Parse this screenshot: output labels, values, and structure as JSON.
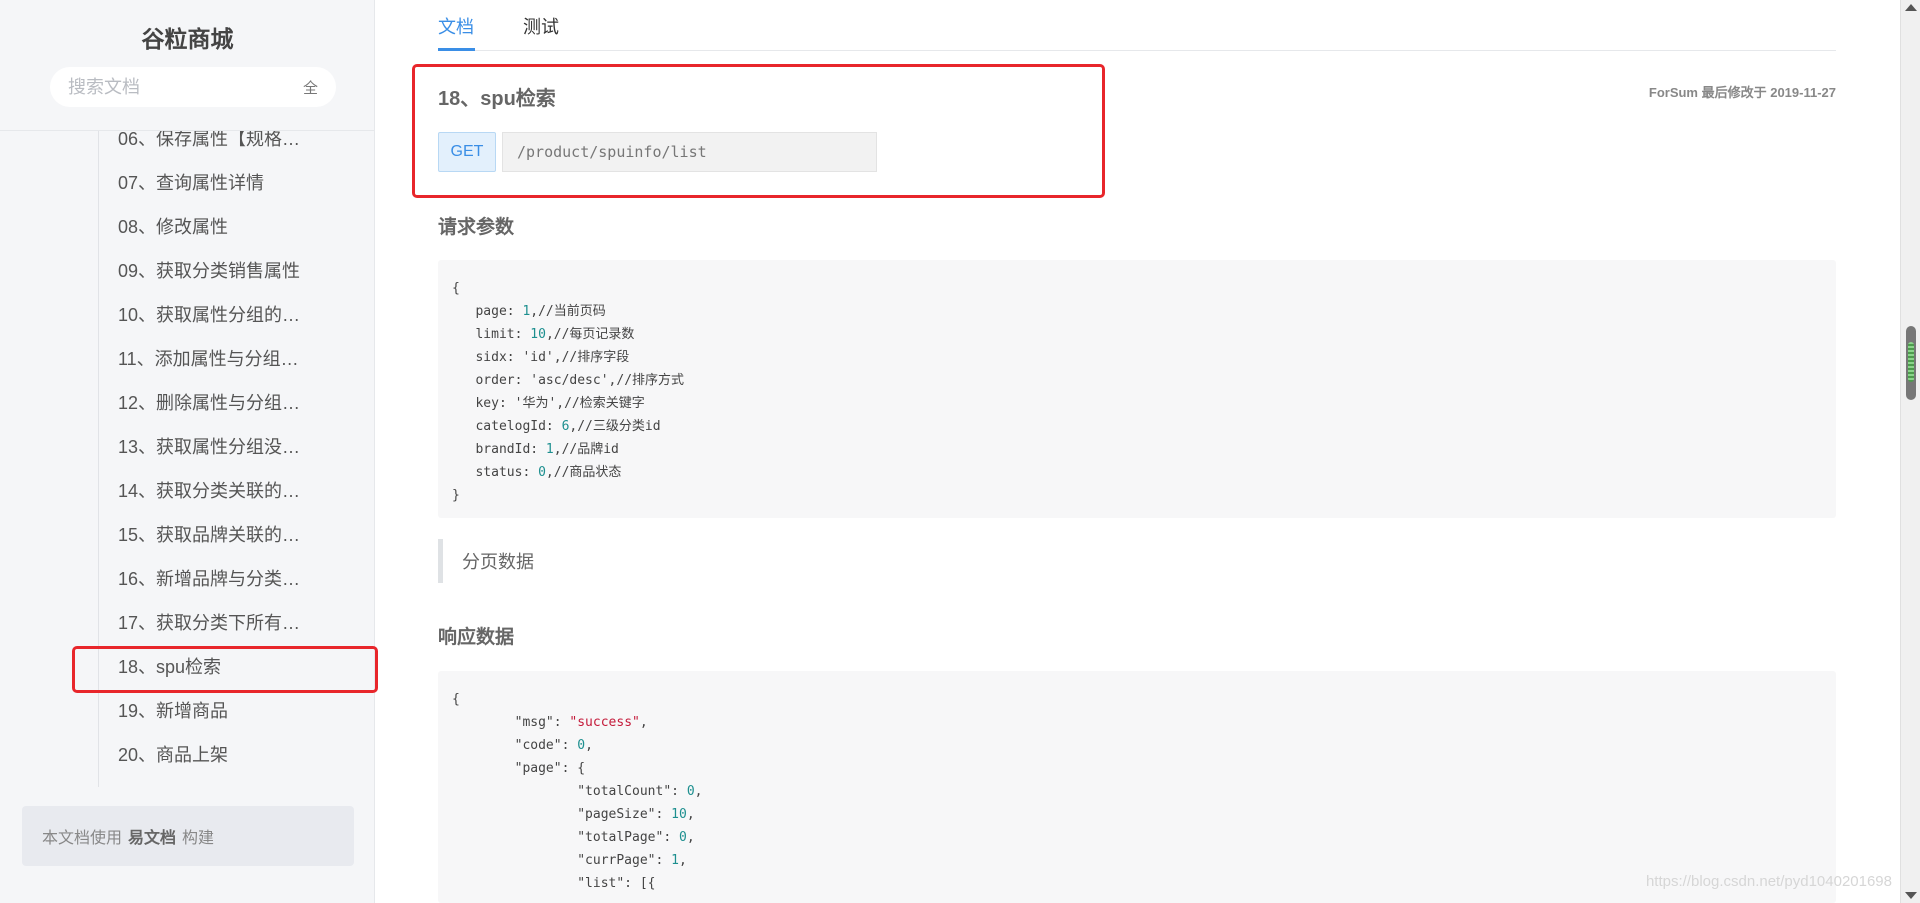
{
  "sidebar": {
    "brand": "谷粒商城",
    "search_placeholder": "搜索文档",
    "search_scope": "全",
    "items": [
      {
        "label": "06、保存属性【规格…"
      },
      {
        "label": "07、查询属性详情"
      },
      {
        "label": "08、修改属性"
      },
      {
        "label": "09、获取分类销售属性"
      },
      {
        "label": "10、获取属性分组的…"
      },
      {
        "label": "11、添加属性与分组…"
      },
      {
        "label": "12、删除属性与分组…"
      },
      {
        "label": "13、获取属性分组没…"
      },
      {
        "label": "14、获取分类关联的…"
      },
      {
        "label": "15、获取品牌关联的…"
      },
      {
        "label": "16、新增品牌与分类…"
      },
      {
        "label": "17、获取分类下所有…"
      },
      {
        "label": "18、spu检索"
      },
      {
        "label": "19、新增商品"
      },
      {
        "label": "20、商品上架"
      }
    ],
    "footer": {
      "prefix": "本文档使用",
      "brand": "易文档",
      "suffix": "构建"
    }
  },
  "tabs": [
    {
      "label": "文档",
      "active": true
    },
    {
      "label": "测试",
      "active": false
    }
  ],
  "doc": {
    "title": "18、spu检索",
    "meta": "ForSum 最后修改于 2019-11-27",
    "method": "GET",
    "path": "/product/spuinfo/list",
    "request_title": "请求参数",
    "request_lines": [
      {
        "k": "{",
        "v": "",
        "c": ""
      },
      {
        "k": "   page: ",
        "v": "1",
        "c": ",//当前页码"
      },
      {
        "k": "   limit: ",
        "v": "10",
        "c": ",//每页记录数"
      },
      {
        "k": "   sidx: 'id'",
        "v": "",
        "c": ",//排序字段"
      },
      {
        "k": "   order: 'asc/desc'",
        "v": "",
        "c": ",//排序方式"
      },
      {
        "k": "   key: '华为'",
        "v": "",
        "c": ",//检索关键字"
      },
      {
        "k": "   catelogId: ",
        "v": "6",
        "c": ",//三级分类id"
      },
      {
        "k": "   brandId: ",
        "v": "1",
        "c": ",//品牌id"
      },
      {
        "k": "   status: ",
        "v": "0",
        "c": ",//商品状态"
      },
      {
        "k": "}",
        "v": "",
        "c": ""
      }
    ],
    "note": "分页数据",
    "response_title": "响应数据",
    "response_lines": [
      {
        "k": "{",
        "v": "",
        "s": "",
        "c": ""
      },
      {
        "k": "        \"msg\": ",
        "v": "",
        "s": "\"success\"",
        "c": ","
      },
      {
        "k": "        \"code\": ",
        "v": "0",
        "s": "",
        "c": ","
      },
      {
        "k": "        \"page\": {",
        "v": "",
        "s": "",
        "c": ""
      },
      {
        "k": "                \"totalCount\": ",
        "v": "0",
        "s": "",
        "c": ","
      },
      {
        "k": "                \"pageSize\": ",
        "v": "10",
        "s": "",
        "c": ","
      },
      {
        "k": "                \"totalPage\": ",
        "v": "0",
        "s": "",
        "c": ","
      },
      {
        "k": "                \"currPage\": ",
        "v": "1",
        "s": "",
        "c": ","
      },
      {
        "k": "                \"list\": [{",
        "v": "",
        "s": "",
        "c": ""
      }
    ]
  },
  "watermark": "https://blog.csdn.net/pyd1040201698"
}
